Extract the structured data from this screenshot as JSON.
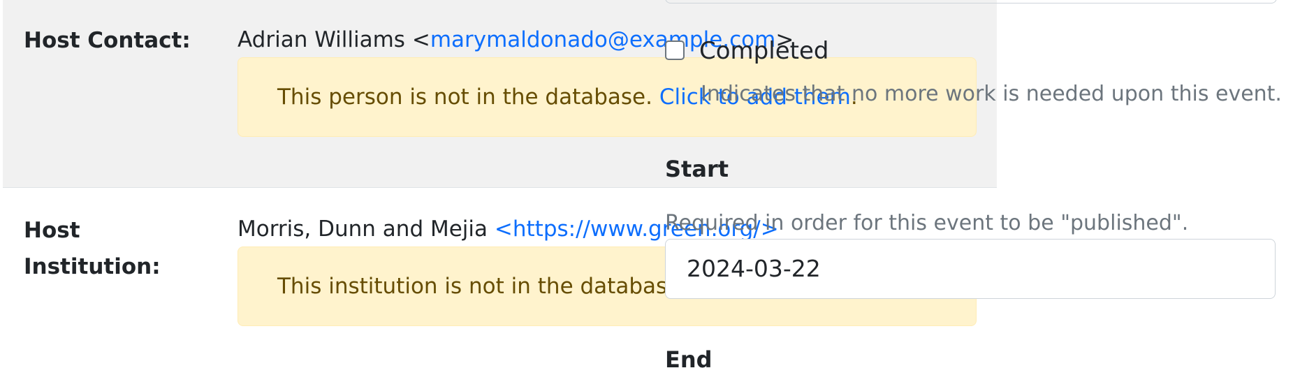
{
  "host_contact": {
    "label": "Host Contact:",
    "name": "Adrian Williams",
    "email": "marymaldonado@example.com",
    "alert_text": "This person is not in the database.",
    "alert_link": "Click to add them",
    "alert_suffix": "."
  },
  "host_institution": {
    "label": "Host Institution:",
    "name": "Morris, Dunn and Mejia",
    "url": "https://www.green.org/",
    "alert_text": "This institution is not in the database. Click to add it."
  },
  "completed": {
    "label": "Completed",
    "help": "Indicates that no more work is needed upon this event.",
    "checked": false
  },
  "start": {
    "label": "Start",
    "help": "Required in order for this event to be \"published\".",
    "value": "2024-03-22"
  },
  "end": {
    "label": "End"
  }
}
